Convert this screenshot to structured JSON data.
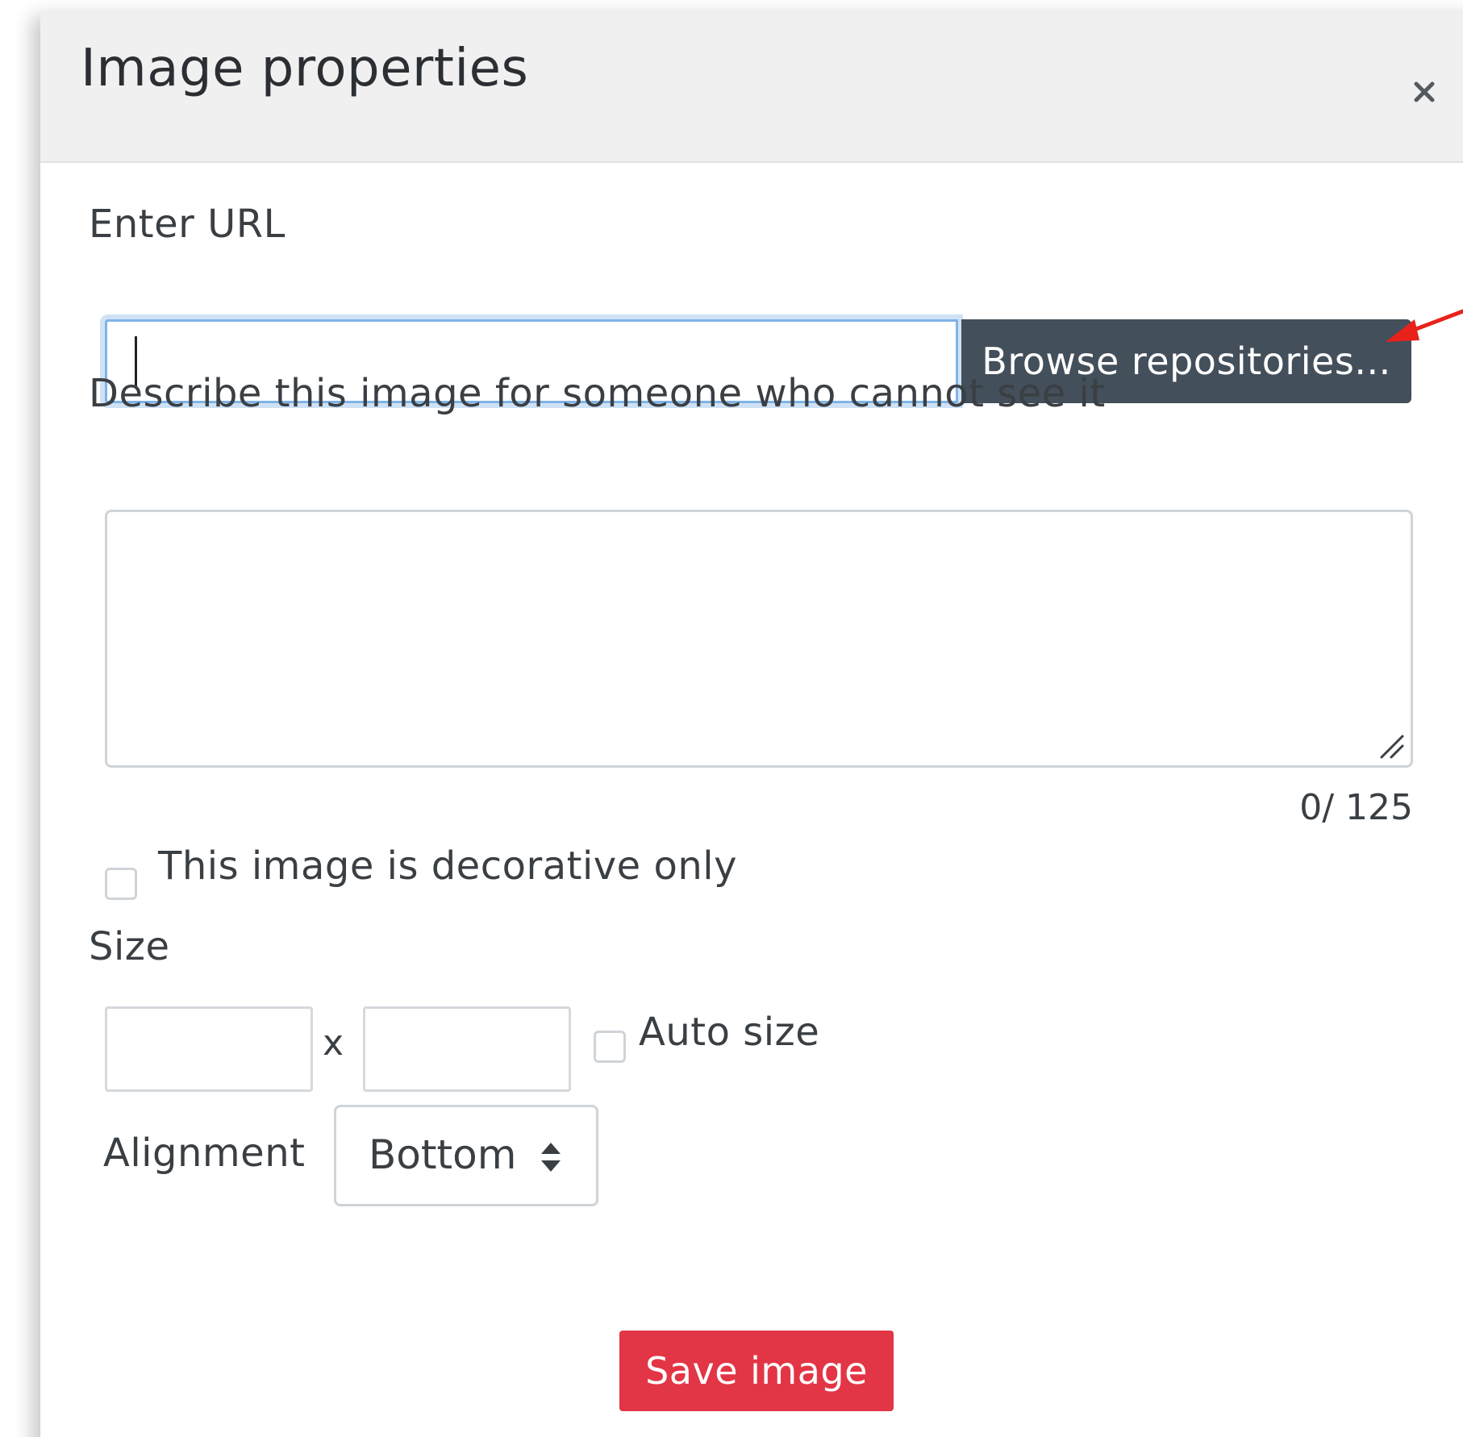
{
  "dialog": {
    "title": "Image properties",
    "close_icon": "close-icon"
  },
  "url_field": {
    "label": "Enter URL",
    "value": "",
    "placeholder": "",
    "browse_button_label": "Browse repositories..."
  },
  "description": {
    "label": "Describe this image for someone who cannot see it",
    "value": "",
    "counter": "0/ 125"
  },
  "decorative": {
    "label": "This image is decorative only",
    "checked": false
  },
  "size": {
    "label": "Size",
    "width_value": "",
    "height_value": "",
    "separator": "x",
    "auto_size_label": "Auto size",
    "auto_size_checked": false
  },
  "alignment": {
    "label": "Alignment",
    "selected": "Bottom",
    "arrow_icon": "sort-arrows-icon"
  },
  "actions": {
    "save_label": "Save image"
  },
  "colors": {
    "header_bg": "#f0f0f0",
    "browse_bg": "#434f5a",
    "save_bg": "#e23546",
    "focus_border": "#7fb3e6",
    "annotation_arrow": "#e8221b"
  }
}
